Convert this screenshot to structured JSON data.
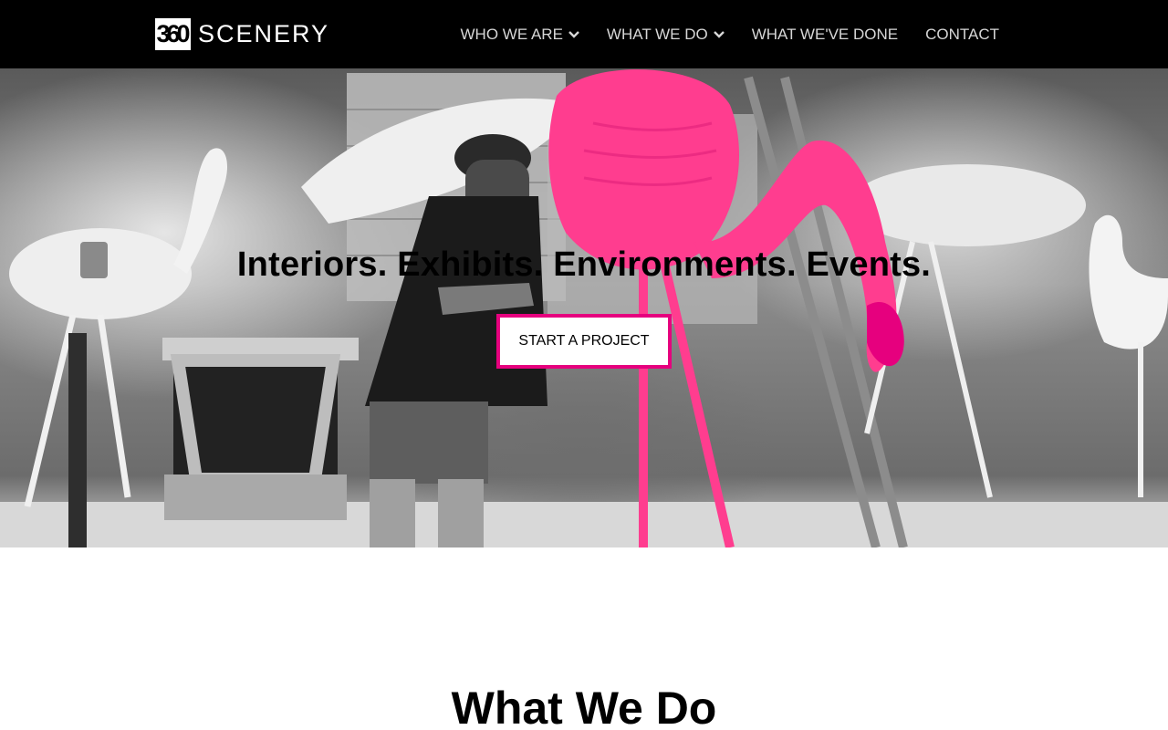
{
  "brand": {
    "logo_mark": "360",
    "logo_word": "SCENERY"
  },
  "nav": {
    "items": [
      {
        "label": "WHO WE ARE",
        "dropdown": true
      },
      {
        "label": "WHAT WE DO",
        "dropdown": true
      },
      {
        "label": "WHAT WE'VE DONE",
        "dropdown": false
      },
      {
        "label": "CONTACT",
        "dropdown": false
      }
    ]
  },
  "hero": {
    "headline": "Interiors. Exhibits. Environments. Events.",
    "cta_label": "START A PROJECT",
    "image_description_icon": "hero-photo-icon"
  },
  "section": {
    "title": "What We Do"
  },
  "colors": {
    "header_bg": "#000000",
    "nav_text": "#d6d6d6",
    "accent_pink": "#e6007e",
    "flamingo_pink": "#ff3d8f"
  }
}
